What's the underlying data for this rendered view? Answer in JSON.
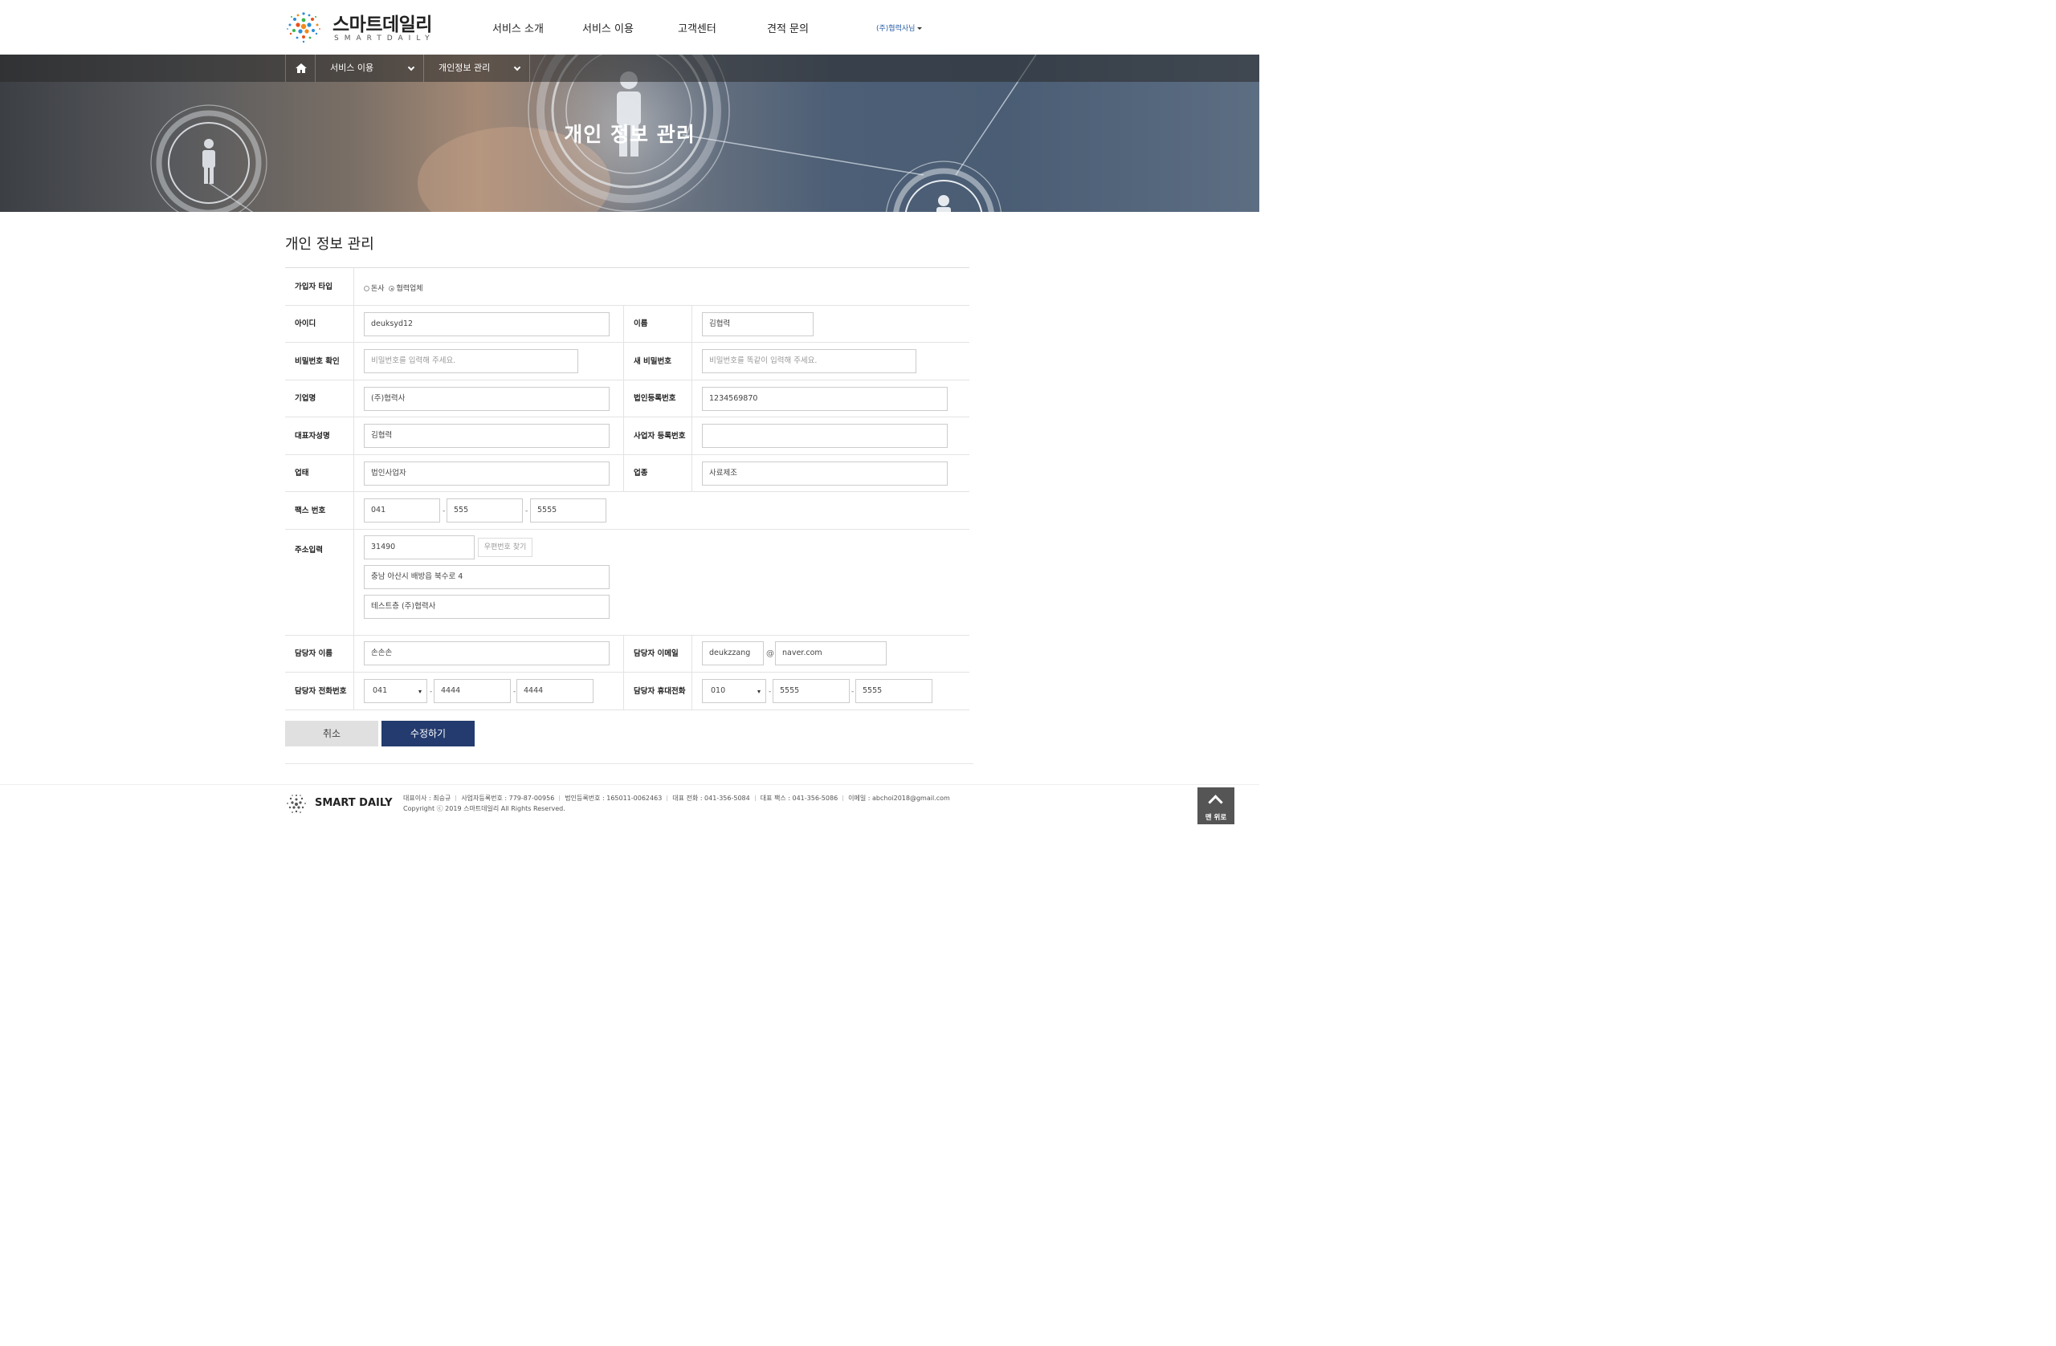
{
  "header": {
    "logo_kr": "스마트데일리",
    "logo_en": "SMARTDAILY",
    "nav": [
      "서비스 소개",
      "서비스 이용",
      "고객센터",
      "견적 문의"
    ],
    "user": "(주)협력사님"
  },
  "hero": {
    "breadcrumb": [
      "서비스 이용",
      "개인정보 관리"
    ],
    "title": "개인 정보 관리"
  },
  "page_title": "개인 정보 관리",
  "form": {
    "member_type": {
      "label": "가입자 타입",
      "options": [
        "돈사",
        "협력업체"
      ],
      "selected": "협력업체"
    },
    "id": {
      "label": "아이디",
      "value": "deuksyd12"
    },
    "name": {
      "label": "이름",
      "value": "김협력"
    },
    "password_confirm": {
      "label": "비밀번호 확인",
      "placeholder": "비밀번호를 입력해 주세요."
    },
    "new_password": {
      "label": "새 비밀번호",
      "placeholder": "비밀번호를 똑같이 입력해 주세요."
    },
    "company": {
      "label": "기업명",
      "value": "(주)협력사"
    },
    "corp_reg_no": {
      "label": "법인등록번호",
      "value": "1234569870"
    },
    "ceo": {
      "label": "대표자성명",
      "value": "김협력"
    },
    "biz_reg_no": {
      "label": "사업자 등록번호",
      "value": ""
    },
    "biz_type": {
      "label": "업태",
      "value": "법인사업자"
    },
    "biz_item": {
      "label": "업종",
      "value": "사료제조"
    },
    "fax": {
      "label": "팩스 번호",
      "parts": [
        "041",
        "555",
        "5555"
      ]
    },
    "address": {
      "label": "주소입력",
      "zip": "31490",
      "zip_button": "우편번호 찾기",
      "line1": "충남 아산시 배방읍 북수로 4",
      "line2": "테스트층 (주)협력사"
    },
    "manager_name": {
      "label": "담당자 이름",
      "value": "손손손"
    },
    "manager_email": {
      "label": "담당자 이메일",
      "local": "deukzzang",
      "at": "@",
      "domain": "naver.com"
    },
    "manager_phone": {
      "label": "담당자 전화번호",
      "parts": [
        "041",
        "4444",
        "4444"
      ]
    },
    "manager_mobile": {
      "label": "담당자 휴대전화",
      "parts": [
        "010",
        "5555",
        "5555"
      ]
    },
    "dash": "-"
  },
  "buttons": {
    "cancel": "취소",
    "submit": "수정하기"
  },
  "footer": {
    "logo": "SMART DAILY",
    "info": [
      "대표이사 : 최승규",
      "사업자등록번호 : 779-87-00956",
      "법인등록번호 : 165011-0062463",
      "대표 전화 : 041-356-5084",
      "대표 팩스 : 041-356-5086",
      "이메일 : abchoi2018@gmail.com"
    ],
    "copyright": "Copyright ⓒ 2019 스마트데일리 All Rights Reserved.",
    "top_button": "맨 위로"
  },
  "colors": {
    "accent": "#233b6e",
    "link": "#2a5ea8"
  }
}
